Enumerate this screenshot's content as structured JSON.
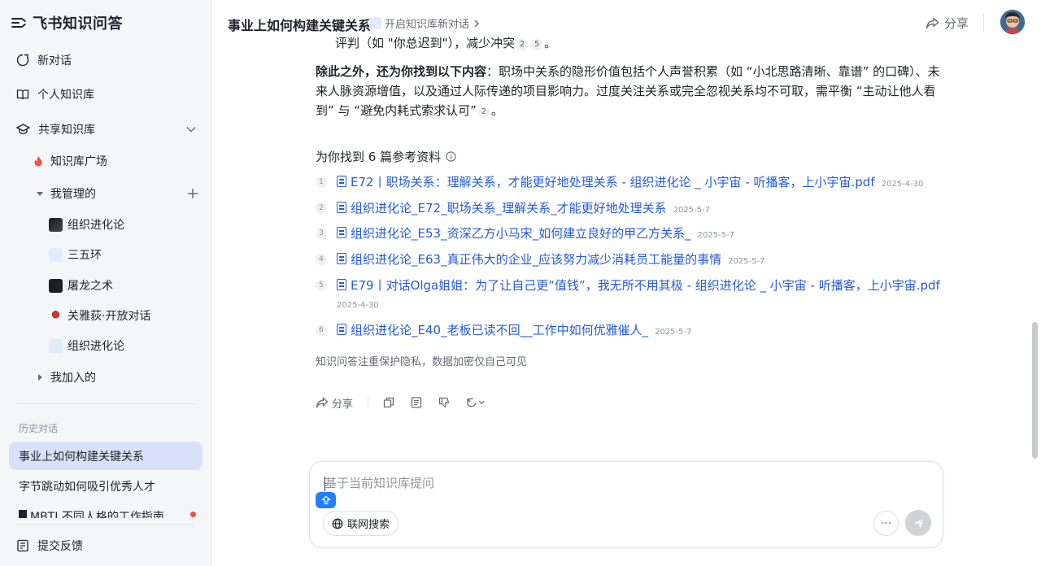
{
  "app": {
    "title": "飞书知识问答"
  },
  "sidebar": {
    "new_chat": "新对话",
    "personal_kb": "个人知识库",
    "shared_kb": "共享知识库",
    "kb_square": "知识库广场",
    "managed": "我管理的",
    "managed_items": [
      {
        "label": "组织进化论"
      },
      {
        "label": "三五环"
      },
      {
        "label": "屠龙之术"
      },
      {
        "label": "关雅荻·开放对话"
      },
      {
        "label": "组织进化论"
      }
    ],
    "joined": "我加入的",
    "history_label": "历史对话",
    "history": [
      {
        "label": "事业上如何构建关键关系"
      },
      {
        "label": "字节跳动如何吸引优秀人才"
      },
      {
        "label": "MBTI 不同人格的工作指南"
      }
    ],
    "feedback": "提交反馈"
  },
  "header": {
    "conversation_title": "事业上如何构建关键关系",
    "kb_link": "开启知识库新对话",
    "share": "分享"
  },
  "answer": {
    "top_line_text": "评判（如 \"你总迟到\"），减少冲突",
    "top_line_cites": [
      "2",
      "5"
    ],
    "top_line_end": "。",
    "bold_lead": "除此之外，还为你找到以下内容",
    "colon": "：",
    "body": "职场中关系的隐形价值包括个人声誉积累（如 “小北思路清晰、靠谱” 的口碑）、未来人脉资源增值，以及通过人际传递的项目影响力。过度关注关系或完全忽视关系均不可取，需平衡 “主动让他人看到” 与 “避免内耗式索求认可”",
    "body_cite": "2",
    "body_end": "。"
  },
  "references": {
    "heading": "为你找到 6 篇参考资料",
    "items": [
      {
        "num": "1",
        "title": "E72丨职场关系：理解关系，才能更好地处理关系 - 组织进化论 _ 小宇宙 - 听播客，上小宇宙.pdf",
        "date": "2025-4-30"
      },
      {
        "num": "2",
        "title": "组织进化论_E72_职场关系_理解关系_才能更好地处理关系",
        "date": "2025-5-7"
      },
      {
        "num": "3",
        "title": "组织进化论_E53_资深乙方小马宋_如何建立良好的甲乙方关系_",
        "date": "2025-5-7"
      },
      {
        "num": "4",
        "title": "组织进化论_E63_真正伟大的企业_应该努力减少消耗员工能量的事情",
        "date": "2025-5-7"
      },
      {
        "num": "5",
        "title": "E79丨对话Olga姐姐：为了让自己更“值钱”，我无所不用其极 - 组织进化论 _ 小宇宙 - 听播客，上小宇宙.pdf",
        "date": "2025-4-30"
      },
      {
        "num": "6",
        "title": "组织进化论_E40_老板已读不回__工作中如何优雅催人_",
        "date": "2025-5-7"
      }
    ]
  },
  "privacy_note": "知识问答注重保护隐私，数据加密仅自己可见",
  "actions": {
    "share": "分享"
  },
  "input": {
    "placeholder": "基于当前知识库提问",
    "web_search": "联网搜索",
    "more": "···"
  },
  "colors": {
    "accent": "#245bdb",
    "active_bg": "#d8e1f7",
    "chip_blue": "#1e7fff"
  }
}
